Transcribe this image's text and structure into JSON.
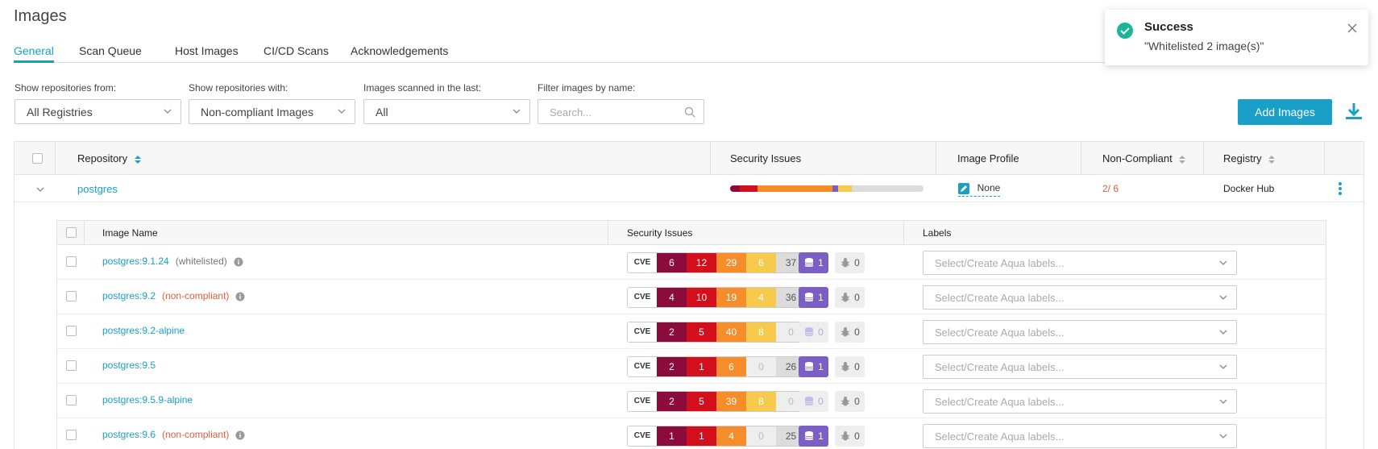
{
  "page": {
    "title": "Images"
  },
  "tabs": [
    {
      "label": "General",
      "active": true
    },
    {
      "label": "Scan Queue"
    },
    {
      "label": "Host Images"
    },
    {
      "label": "CI/CD Scans"
    },
    {
      "label": "Acknowledgements"
    }
  ],
  "filters": {
    "repos_from_label": "Show repositories from:",
    "repos_from_value": "All Registries",
    "repos_with_label": "Show repositories with:",
    "repos_with_value": "Non-compliant Images",
    "scanned_label": "Images scanned in the last:",
    "scanned_value": "All",
    "name_label": "Filter images by name:",
    "name_placeholder": "Search..."
  },
  "actions": {
    "add_images": "Add Images"
  },
  "table": {
    "headers": {
      "repository": "Repository",
      "security": "Security Issues",
      "profile": "Image Profile",
      "noncompliant": "Non-Compliant",
      "registry": "Registry"
    },
    "repo": {
      "name": "postgres",
      "profile": "None",
      "noncompliant": "2/ 6",
      "registry": "Docker Hub",
      "bar_fractions": {
        "critical_dark": 0.05,
        "critical": 0.09,
        "high": 0.39,
        "purple": 0.03,
        "medium": 0.07,
        "low": 0.37
      }
    }
  },
  "subtable": {
    "headers": {
      "name": "Image Name",
      "security": "Security Issues",
      "labels": "Labels"
    },
    "cve_tag": "CVE",
    "label_placeholder": "Select/Create Aqua labels...",
    "rows": [
      {
        "name": "postgres:9.1.24",
        "status": "(whitelisted)",
        "status_type": "whitelisted",
        "info": true,
        "cve": [
          "6",
          "12",
          "29",
          "6",
          "37"
        ],
        "malware": "1",
        "malware_active": true,
        "bugs": "0"
      },
      {
        "name": "postgres:9.2",
        "status": "(non-compliant)",
        "status_type": "noncompliant",
        "info": true,
        "cve": [
          "4",
          "10",
          "19",
          "4",
          "36"
        ],
        "malware": "1",
        "malware_active": true,
        "bugs": "0"
      },
      {
        "name": "postgres:9.2-alpine",
        "status": "",
        "status_type": "",
        "info": false,
        "cve": [
          "2",
          "5",
          "40",
          "8",
          "0"
        ],
        "malware": "0",
        "malware_active": false,
        "bugs": "0"
      },
      {
        "name": "postgres:9.5",
        "status": "",
        "status_type": "",
        "info": false,
        "cve": [
          "2",
          "1",
          "6",
          "0",
          "26"
        ],
        "malware": "1",
        "malware_active": true,
        "bugs": "0"
      },
      {
        "name": "postgres:9.5.9-alpine",
        "status": "",
        "status_type": "",
        "info": false,
        "cve": [
          "2",
          "5",
          "39",
          "8",
          "0"
        ],
        "malware": "0",
        "malware_active": false,
        "bugs": "0"
      },
      {
        "name": "postgres:9.6",
        "status": "(non-compliant)",
        "status_type": "noncompliant",
        "info": true,
        "cve": [
          "1",
          "1",
          "4",
          "0",
          "25"
        ],
        "malware": "1",
        "malware_active": true,
        "bugs": "0"
      }
    ]
  },
  "toast": {
    "title": "Success",
    "message": "\"Whitelisted 2 image(s)\""
  },
  "colors": {
    "accent": "#1aa0c8",
    "critical_dark": "#8b0b3c",
    "critical": "#d40f1d",
    "high": "#f68d2a",
    "medium": "#f7c94c",
    "low": "#dcdcdc",
    "malware": "#7b5fc4",
    "success": "#1bb598"
  }
}
